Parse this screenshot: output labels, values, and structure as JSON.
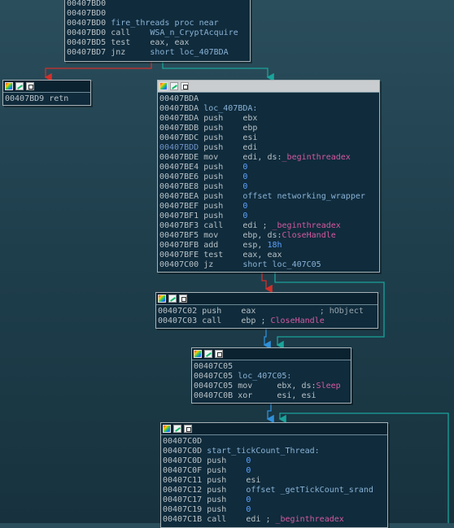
{
  "blocks": [
    {
      "id": "fire-threads",
      "lines": [
        {
          "addr": "00407BD0",
          "parts": []
        },
        {
          "addr": "00407BD0",
          "parts": []
        },
        {
          "addr": "00407BD0",
          "parts": [
            {
              "t": "fire_threads proc near",
              "c": "lbl"
            }
          ]
        },
        {
          "addr": "00407BD0",
          "parts": [
            {
              "t": "call    ",
              "c": "kw"
            },
            {
              "t": "WSA_n_CryptAcquire",
              "c": "lbl"
            }
          ]
        },
        {
          "addr": "00407BD5",
          "parts": [
            {
              "t": "test    eax, eax",
              "c": "kw"
            }
          ]
        },
        {
          "addr": "00407BD7",
          "parts": [
            {
              "t": "jnz     ",
              "c": "kw"
            },
            {
              "t": "short loc_407BDA",
              "c": "lbl"
            }
          ]
        }
      ]
    },
    {
      "id": "retn",
      "lines": [
        {
          "addr": "00407BD9",
          "parts": [
            {
              "t": "retn",
              "c": "kw"
            }
          ]
        }
      ]
    },
    {
      "id": "loc-407bda",
      "lines": [
        {
          "addr": "00407BDA",
          "parts": []
        },
        {
          "addr": "00407BDA",
          "parts": [
            {
              "t": "loc_407BDA:",
              "c": "lbl"
            }
          ]
        },
        {
          "addr": "00407BDA",
          "parts": [
            {
              "t": "push    ebx",
              "c": "kw"
            }
          ]
        },
        {
          "addr": "00407BDB",
          "parts": [
            {
              "t": "push    ebp",
              "c": "kw"
            }
          ]
        },
        {
          "addr": "00407BDC",
          "parts": [
            {
              "t": "push    esi",
              "c": "kw"
            }
          ]
        },
        {
          "addr": "00407BDD",
          "hl": true,
          "parts": [
            {
              "t": "push    edi",
              "c": "kw"
            }
          ]
        },
        {
          "addr": "00407BDE",
          "parts": [
            {
              "t": "mov     edi, ds:",
              "c": "kw"
            },
            {
              "t": "_beginthreadex",
              "c": "api"
            }
          ]
        },
        {
          "addr": "00407BE4",
          "parts": [
            {
              "t": "push    ",
              "c": "kw"
            },
            {
              "t": "0",
              "c": "imm"
            }
          ]
        },
        {
          "addr": "00407BE6",
          "parts": [
            {
              "t": "push    ",
              "c": "kw"
            },
            {
              "t": "0",
              "c": "imm"
            }
          ]
        },
        {
          "addr": "00407BE8",
          "parts": [
            {
              "t": "push    ",
              "c": "kw"
            },
            {
              "t": "0",
              "c": "imm"
            }
          ]
        },
        {
          "addr": "00407BEA",
          "parts": [
            {
              "t": "push    ",
              "c": "kw"
            },
            {
              "t": "offset networking_wrapper",
              "c": "lbl"
            }
          ]
        },
        {
          "addr": "00407BEF",
          "parts": [
            {
              "t": "push    ",
              "c": "kw"
            },
            {
              "t": "0",
              "c": "imm"
            }
          ]
        },
        {
          "addr": "00407BF1",
          "parts": [
            {
              "t": "push    ",
              "c": "kw"
            },
            {
              "t": "0",
              "c": "imm"
            }
          ]
        },
        {
          "addr": "00407BF3",
          "parts": [
            {
              "t": "call    edi ; ",
              "c": "kw"
            },
            {
              "t": "_beginthreadex",
              "c": "api"
            }
          ]
        },
        {
          "addr": "00407BF5",
          "parts": [
            {
              "t": "mov     ebp, ds:",
              "c": "kw"
            },
            {
              "t": "CloseHandle",
              "c": "api"
            }
          ]
        },
        {
          "addr": "00407BFB",
          "parts": [
            {
              "t": "add     esp, ",
              "c": "kw"
            },
            {
              "t": "18h",
              "c": "imm"
            }
          ]
        },
        {
          "addr": "00407BFE",
          "parts": [
            {
              "t": "test    eax, eax",
              "c": "kw"
            }
          ]
        },
        {
          "addr": "00407C00",
          "parts": [
            {
              "t": "jz      ",
              "c": "kw"
            },
            {
              "t": "short loc_407C05",
              "c": "lbl"
            }
          ]
        }
      ]
    },
    {
      "id": "closehandle",
      "lines": [
        {
          "addr": "00407C02",
          "parts": [
            {
              "t": "push    eax",
              "c": "kw"
            },
            {
              "t": "             ; hObject",
              "c": "cmt"
            }
          ]
        },
        {
          "addr": "00407C03",
          "parts": [
            {
              "t": "call    ebp ; ",
              "c": "kw"
            },
            {
              "t": "CloseHandle",
              "c": "api"
            }
          ]
        }
      ]
    },
    {
      "id": "loc-407c05",
      "lines": [
        {
          "addr": "00407C05",
          "parts": []
        },
        {
          "addr": "00407C05",
          "parts": [
            {
              "t": "loc_407C05:",
              "c": "lbl"
            }
          ]
        },
        {
          "addr": "00407C05",
          "parts": [
            {
              "t": "mov     ebx, ds:",
              "c": "kw"
            },
            {
              "t": "Sleep",
              "c": "api"
            }
          ]
        },
        {
          "addr": "00407C0B",
          "parts": [
            {
              "t": "xor     esi, esi",
              "c": "kw"
            }
          ]
        }
      ]
    },
    {
      "id": "tickcount-thread",
      "lines": [
        {
          "addr": "00407C0D",
          "parts": []
        },
        {
          "addr": "00407C0D",
          "parts": [
            {
              "t": "start_tickCount_Thread:",
              "c": "lbl"
            }
          ]
        },
        {
          "addr": "00407C0D",
          "parts": [
            {
              "t": "push    ",
              "c": "kw"
            },
            {
              "t": "0",
              "c": "imm"
            }
          ]
        },
        {
          "addr": "00407C0F",
          "parts": [
            {
              "t": "push    ",
              "c": "kw"
            },
            {
              "t": "0",
              "c": "imm"
            }
          ]
        },
        {
          "addr": "00407C11",
          "parts": [
            {
              "t": "push    esi",
              "c": "kw"
            }
          ]
        },
        {
          "addr": "00407C12",
          "parts": [
            {
              "t": "push    ",
              "c": "kw"
            },
            {
              "t": "offset _getTickCount_srand",
              "c": "lbl"
            }
          ]
        },
        {
          "addr": "00407C17",
          "parts": [
            {
              "t": "push    ",
              "c": "kw"
            },
            {
              "t": "0",
              "c": "imm"
            }
          ]
        },
        {
          "addr": "00407C19",
          "parts": [
            {
              "t": "push    ",
              "c": "kw"
            },
            {
              "t": "0",
              "c": "imm"
            }
          ]
        },
        {
          "addr": "00407C1B",
          "parts": [
            {
              "t": "call    edi ; ",
              "c": "kw"
            },
            {
              "t": "_beginthreadex",
              "c": "api"
            }
          ]
        }
      ]
    }
  ],
  "colors": {
    "background": "#1f3f4d",
    "block_bg": "#0f2b3c",
    "edge_true": "#1aa39a",
    "edge_false": "#d0302b",
    "edge_uncond": "#2f8fd8",
    "api_name": "#d55aa0",
    "immediate": "#5ea2ff"
  }
}
